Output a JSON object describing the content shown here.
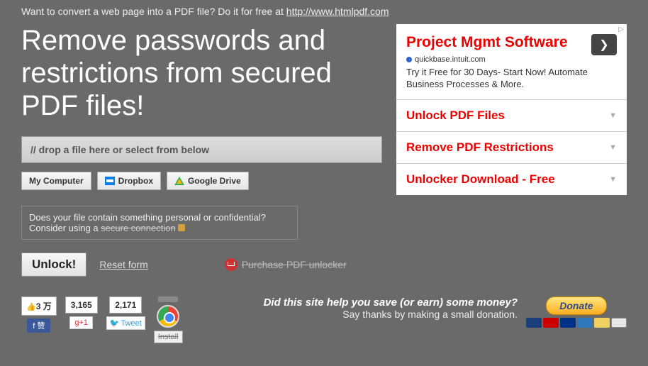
{
  "promo": {
    "text": "Want to convert a web page into a PDF file? Do it for free at ",
    "link": "http://www.htmlpdf.com"
  },
  "headline": "Remove passwords and restrictions from secured PDF files!",
  "dropzone": "// drop a file here or select from below",
  "sources": {
    "computer": "My Computer",
    "dropbox": "Dropbox",
    "gdrive": "Google Drive"
  },
  "confidential": {
    "line1": "Does your file contain something personal or confidential?",
    "line2_pre": "Consider using a ",
    "secure": "secure connection"
  },
  "actions": {
    "unlock": "Unlock!",
    "reset": "Reset form",
    "purchase": "Purchase PDF unlocker"
  },
  "ad": {
    "title": "Project Mgmt Software",
    "domain": "quickbase.intuit.com",
    "desc": "Try it Free for 30 Days- Start Now! Automate Business Processes & More.",
    "links": [
      "Unlock PDF Files",
      "Remove PDF Restrictions",
      "Unlocker Download - Free"
    ]
  },
  "social": {
    "fb_count": "3 万",
    "fb_label": "赞",
    "gp_count": "3,165",
    "gp_label": "g+1",
    "tw_count": "2,171",
    "tw_label": "Tweet",
    "install": "Install"
  },
  "donate": {
    "question": "Did this site help you save (or earn) some money?",
    "sub": "Say thanks by making a small donation.",
    "button": "Donate"
  }
}
